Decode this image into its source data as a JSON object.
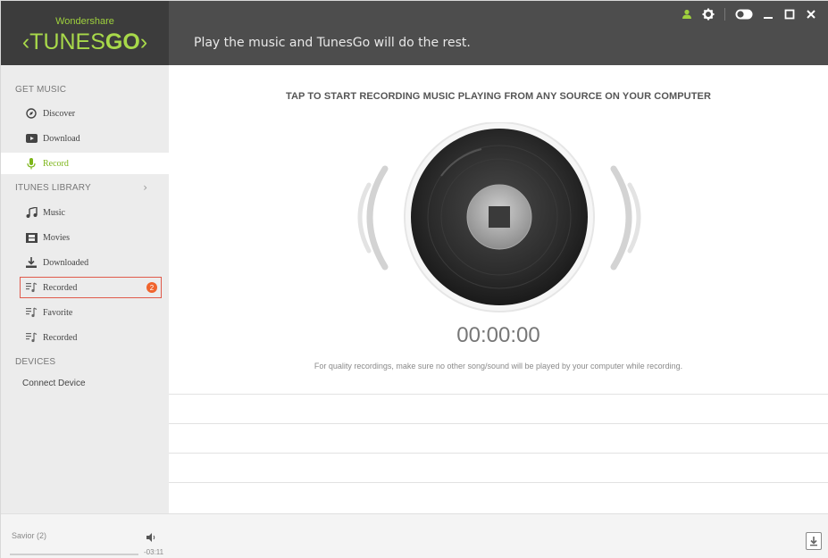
{
  "header": {
    "brand_sub": "Wondershare",
    "brand_main_a": "TUNES",
    "brand_main_b": "GO",
    "tagline": "Play the music and TunesGo will do the rest."
  },
  "window_controls": [
    "user-icon",
    "settings-icon",
    "toggle-icon",
    "minimize-icon",
    "maximize-icon",
    "close-icon"
  ],
  "sidebar": {
    "get_music": {
      "title": "GET MUSIC",
      "items": [
        {
          "label": "Discover",
          "icon": "compass-icon"
        },
        {
          "label": "Download",
          "icon": "video-icon"
        },
        {
          "label": "Record",
          "icon": "microphone-icon",
          "active": true
        }
      ]
    },
    "itunes_library": {
      "title": "ITUNES LIBRARY",
      "items": [
        {
          "label": "Music",
          "icon": "music-note-icon"
        },
        {
          "label": "Movies",
          "icon": "film-icon"
        },
        {
          "label": "Downloaded",
          "icon": "download-icon"
        },
        {
          "label": "Recorded",
          "icon": "playlist-icon",
          "badge": "2",
          "highlighted": true
        },
        {
          "label": "Favorite",
          "icon": "playlist-icon"
        },
        {
          "label": "Recorded",
          "icon": "playlist-icon"
        }
      ]
    },
    "devices": {
      "title": "DEVICES",
      "connect": "Connect Device"
    }
  },
  "main": {
    "instruction": "TAP TO START RECORDING MUSIC PLAYING FROM ANY SOURCE ON YOUR COMPUTER",
    "timer": "00:00:00",
    "note": "For quality recordings, make sure no other song/sound will be played by your computer while recording."
  },
  "footer": {
    "song": "Savior (2)",
    "time": "-03:11"
  },
  "colors": {
    "accent_green": "#7cb518",
    "header_bg": "#4d4d4d",
    "badge_orange": "#f0642d",
    "highlight_red": "#e05a4b"
  }
}
